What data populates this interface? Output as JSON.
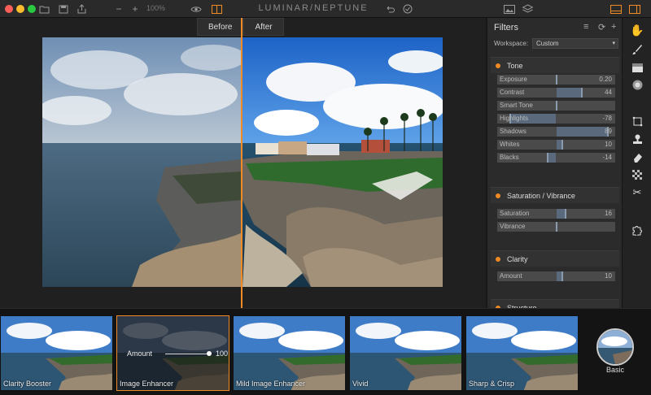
{
  "app": {
    "title": "LUMINAR/NEPTUNE",
    "zoom": "100%"
  },
  "compare": {
    "before": "Before",
    "after": "After"
  },
  "toolbar": {
    "icons": [
      "folder-icon",
      "save-icon",
      "share-icon",
      "zoom-out-icon",
      "zoom-in-icon",
      "eye-icon",
      "compare-icon",
      "undo-icon",
      "history-icon",
      "image-icon",
      "layers-icon",
      "layout-icon",
      "panel-toggle-icon"
    ]
  },
  "filters": {
    "title": "Filters",
    "workspace_label": "Workspace:",
    "workspace_value": "Custom",
    "sections": [
      {
        "name": "Tone",
        "sliders": [
          {
            "label": "Exposure",
            "value": "0.20",
            "pos": 0.5
          },
          {
            "label": "Contrast",
            "value": "44",
            "pos": 0.72
          },
          {
            "label": "Smart Tone",
            "value": "",
            "pos": 0.5
          },
          {
            "label": "Highlights",
            "value": "-78",
            "pos": 0.11
          },
          {
            "label": "Shadows",
            "value": "89",
            "pos": 0.94
          },
          {
            "label": "Whites",
            "value": "10",
            "pos": 0.55
          },
          {
            "label": "Blacks",
            "value": "-14",
            "pos": 0.43
          }
        ]
      },
      {
        "name": "Saturation / Vibrance",
        "sliders": [
          {
            "label": "Saturation",
            "value": "16",
            "pos": 0.58
          },
          {
            "label": "Vibrance",
            "value": "",
            "pos": 0.5
          }
        ]
      },
      {
        "name": "Clarity",
        "sliders": [
          {
            "label": "Amount",
            "value": "10",
            "pos": 0.55
          }
        ]
      },
      {
        "name": "Structure",
        "sliders": []
      }
    ]
  },
  "tools": [
    "hand-icon",
    "brush-icon",
    "gradient-icon",
    "radial-mask-icon",
    "crop-icon",
    "clone-stamp-icon",
    "eraser-icon",
    "texture-icon",
    "cut-icon",
    "puzzle-icon"
  ],
  "presets": [
    {
      "name": "Clarity Booster",
      "selected": false
    },
    {
      "name": "Image Enhancer",
      "selected": true,
      "amount_label": "Amount",
      "amount": "100"
    },
    {
      "name": "Mild Image Enhancer",
      "selected": false
    },
    {
      "name": "Vivid",
      "selected": false
    },
    {
      "name": "Sharp & Crisp",
      "selected": false
    }
  ],
  "preset_category": "Basic",
  "colors": {
    "accent": "#f08a24",
    "panel": "#2b2b2b",
    "slider_fill": "#5a6a7c"
  }
}
